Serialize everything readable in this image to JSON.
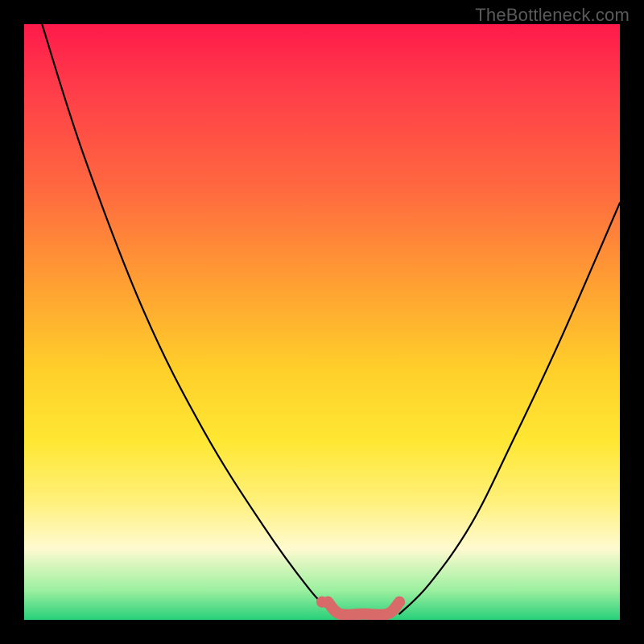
{
  "watermark": "TheBottleneck.com",
  "chart_data": {
    "type": "line",
    "title": "",
    "xlabel": "",
    "ylabel": "",
    "xlim": [
      0,
      100
    ],
    "ylim": [
      0,
      100
    ],
    "series": [
      {
        "name": "left-curve",
        "x": [
          3,
          10,
          20,
          30,
          40,
          48,
          52
        ],
        "values": [
          100,
          78,
          52,
          32,
          16,
          5,
          1
        ]
      },
      {
        "name": "right-curve",
        "x": [
          63,
          68,
          75,
          82,
          90,
          100
        ],
        "values": [
          1,
          6,
          16,
          30,
          47,
          70
        ]
      },
      {
        "name": "bottom-highlight",
        "x": [
          51,
          53,
          57,
          61,
          63
        ],
        "values": [
          3,
          1,
          1,
          1,
          3
        ]
      }
    ],
    "annotations": [
      {
        "type": "dot",
        "name": "left-dot",
        "x": 50,
        "y": 3
      }
    ],
    "colors": {
      "curve": "#000000",
      "highlight": "#d86a6a",
      "background_top": "#ff1a4a",
      "background_bottom": "#28d07a",
      "frame": "#000000"
    }
  }
}
